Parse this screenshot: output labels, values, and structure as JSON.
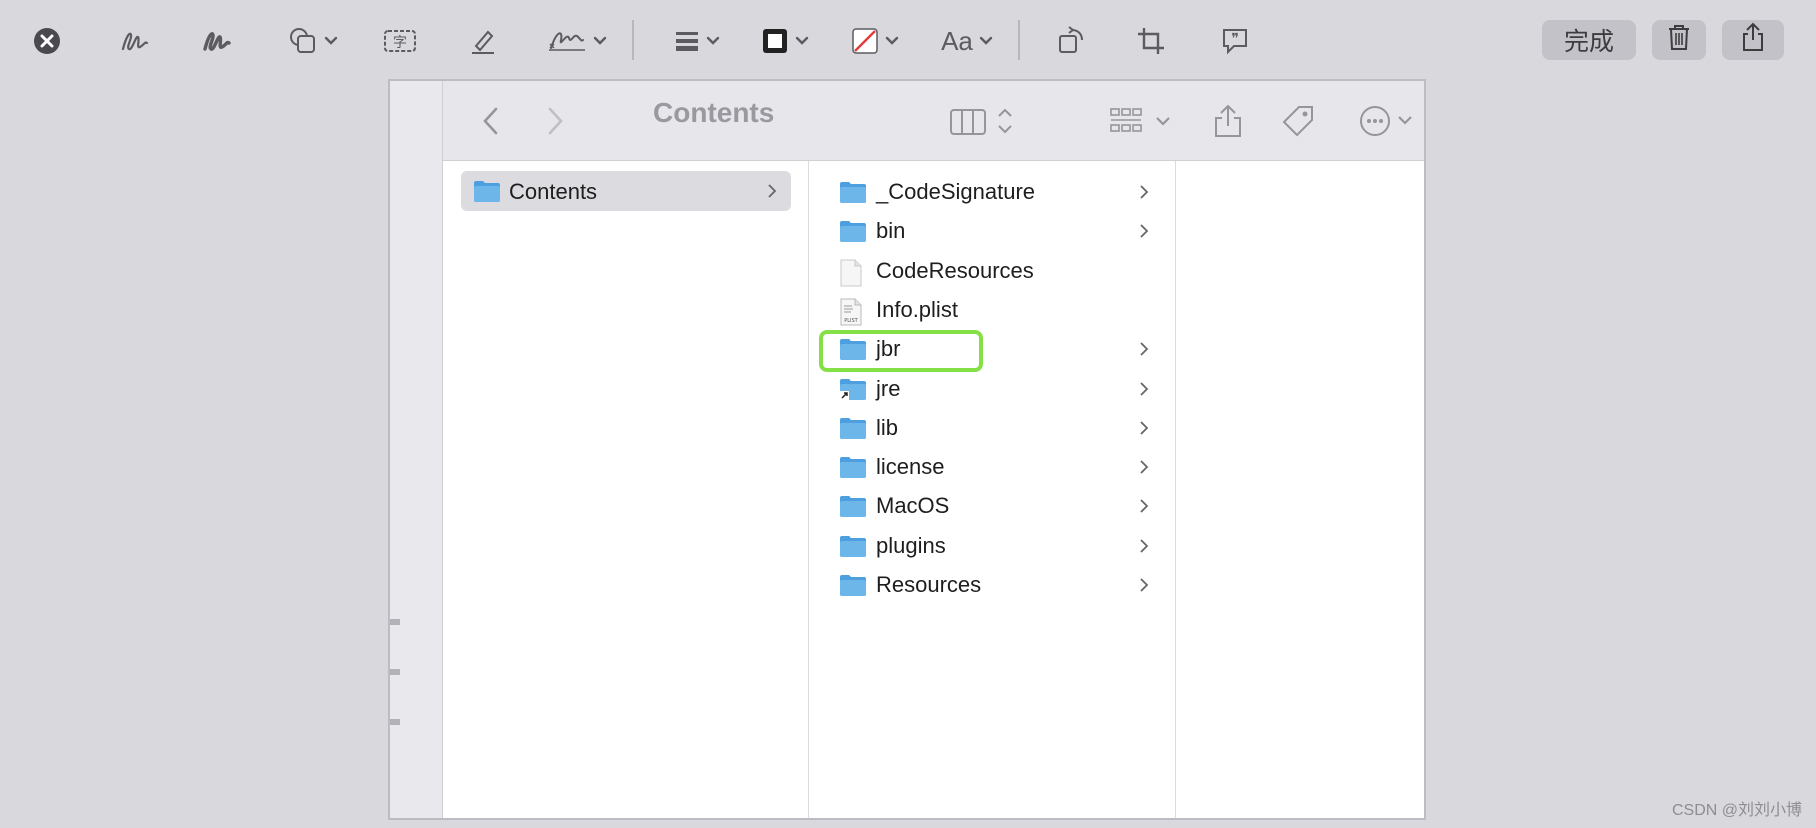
{
  "toolbar": {
    "tools": [
      {
        "icon": "close-circle-icon"
      },
      {
        "icon": "sketch-icon"
      },
      {
        "icon": "draw-icon"
      },
      {
        "icon": "shapes-icon"
      },
      {
        "icon": "text-box-icon",
        "glyph": "字"
      },
      {
        "icon": "highlight-pen-icon"
      },
      {
        "icon": "signature-icon"
      },
      {
        "icon": "line-style-icon"
      },
      {
        "icon": "border-color-icon"
      },
      {
        "icon": "fill-color-icon"
      },
      {
        "icon": "font-icon",
        "label": "Aa"
      },
      {
        "icon": "rotate-icon"
      },
      {
        "icon": "crop-icon"
      },
      {
        "icon": "description-icon"
      }
    ],
    "done_label": "完成",
    "delete_icon": "trash-icon",
    "share_icon": "share-icon"
  },
  "finder": {
    "title": "Contents",
    "left_column": [
      {
        "name": "Contents",
        "kind": "folder",
        "selected": true
      }
    ],
    "middle_column": [
      {
        "name": "_CodeSignature",
        "kind": "folder"
      },
      {
        "name": "bin",
        "kind": "folder"
      },
      {
        "name": "CodeResources",
        "kind": "file"
      },
      {
        "name": "Info.plist",
        "kind": "plist"
      },
      {
        "name": "jbr",
        "kind": "folder",
        "highlighted": true
      },
      {
        "name": "jre",
        "kind": "alias-folder"
      },
      {
        "name": "lib",
        "kind": "folder"
      },
      {
        "name": "license",
        "kind": "folder"
      },
      {
        "name": "MacOS",
        "kind": "folder"
      },
      {
        "name": "plugins",
        "kind": "folder"
      },
      {
        "name": "Resources",
        "kind": "folder"
      }
    ]
  },
  "colors": {
    "highlight": "#84e044",
    "folder": "#6cb6ea",
    "background": "#d9d8dd"
  },
  "watermark": "CSDN @刘刘小博"
}
